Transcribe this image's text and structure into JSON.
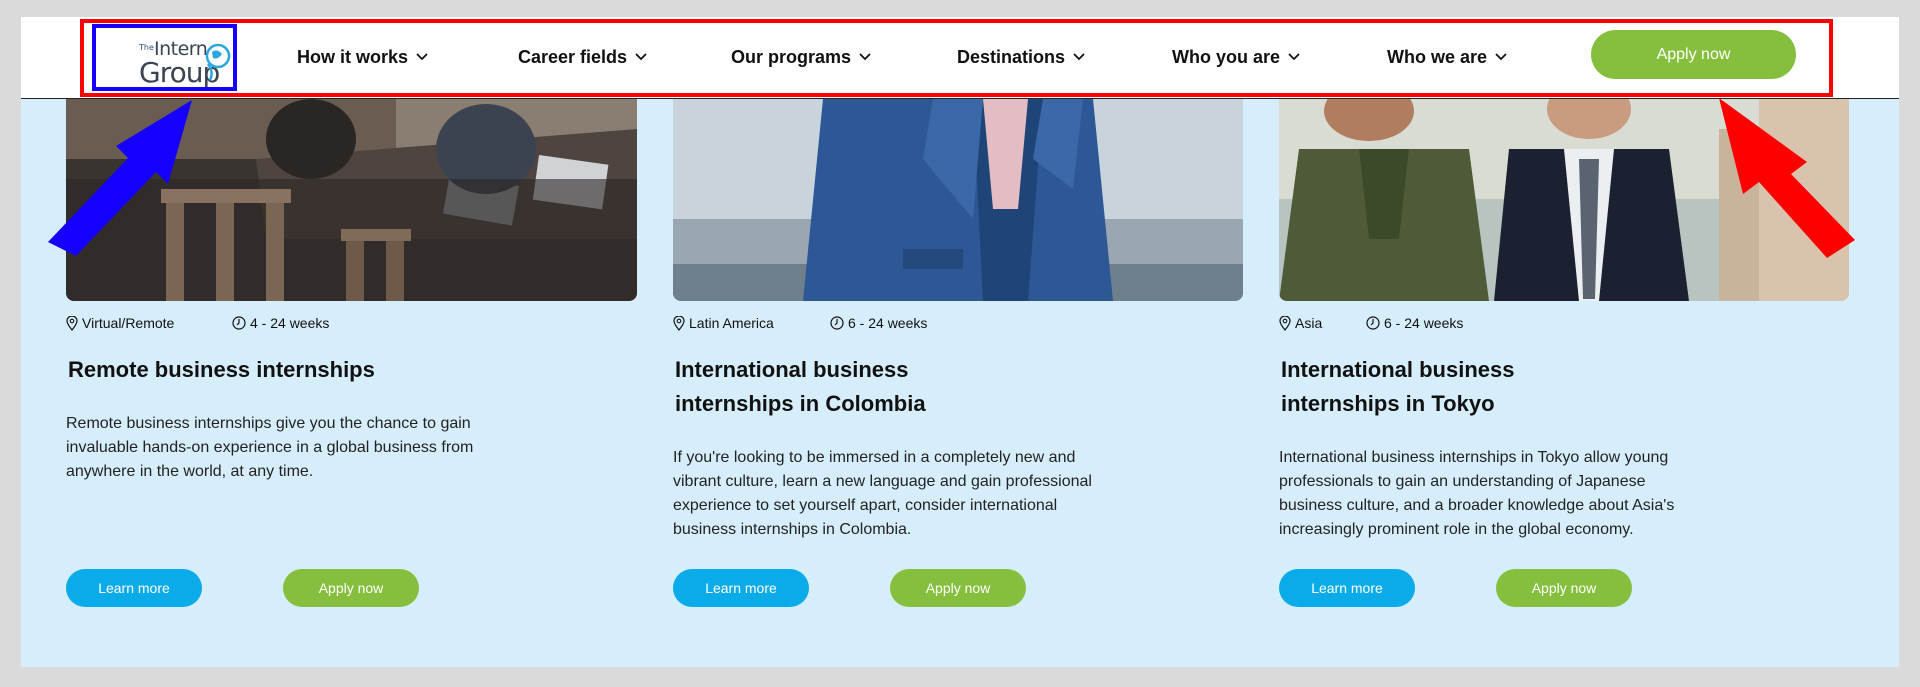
{
  "logo": {
    "the": "The",
    "intern": "Intern",
    "group": "Group"
  },
  "nav": [
    {
      "label": "How it works"
    },
    {
      "label": "Career fields"
    },
    {
      "label": "Our programs"
    },
    {
      "label": "Destinations"
    },
    {
      "label": "Who you are"
    },
    {
      "label": "Who we are"
    }
  ],
  "header_apply_label": "Apply now",
  "cards": [
    {
      "location": "Virtual/Remote",
      "duration": "4 - 24 weeks",
      "title": "Remote business internships",
      "description": "Remote business internships give you the chance to gain invaluable hands-on experience in a global business from anywhere in the world, at any time.",
      "learn_label": "Learn more",
      "apply_label": "Apply now"
    },
    {
      "location": "Latin America",
      "duration": "6 - 24 weeks",
      "title": "International business internships in Colombia",
      "description": "If you're looking to be immersed in a completely new and vibrant culture, learn a new language and gain professional experience to set yourself apart, consider international business internships in Colombia.",
      "learn_label": "Learn more",
      "apply_label": "Apply now"
    },
    {
      "location": "Asia",
      "duration": "6 - 24 weeks",
      "title": "International business internships in Tokyo",
      "description": "International business internships in Tokyo allow young professionals to gain an understanding of Japanese business culture, and a broader knowledge about Asia's increasingly prominent role in the global economy.",
      "learn_label": "Learn more",
      "apply_label": "Apply now"
    }
  ],
  "colors": {
    "page_background": "#d6eefb",
    "learn_button": "#0aabe9",
    "apply_button": "#86bf3d",
    "annotation_red": "#ff0000",
    "annotation_blue": "#1500ff"
  }
}
